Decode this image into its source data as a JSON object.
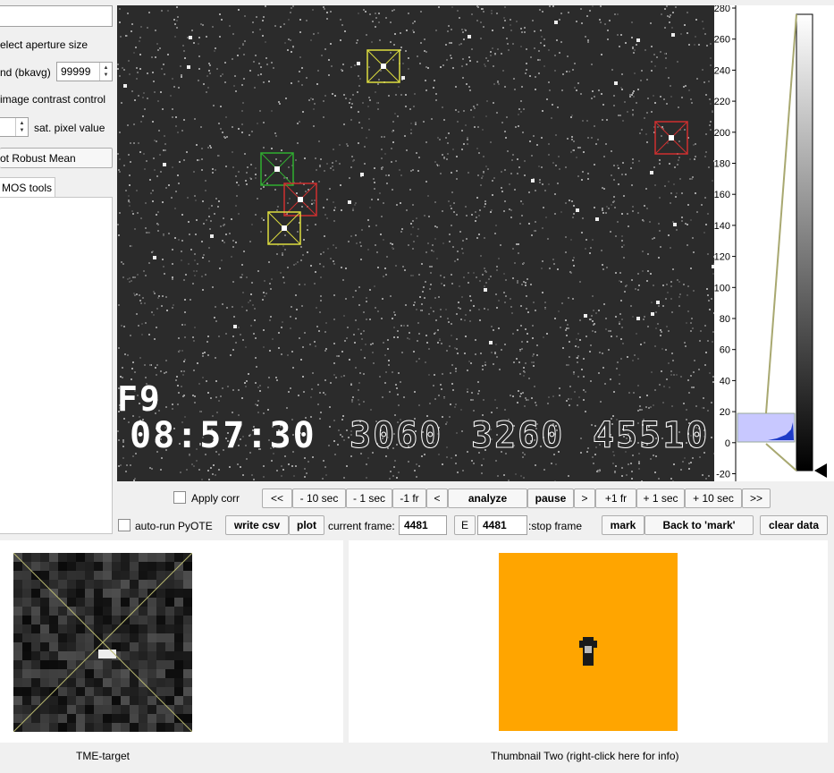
{
  "left_panel": {
    "input_value": "",
    "aperture_label": "elect aperture size",
    "bkavg_label": "nd (bkavg)",
    "bkavg_value": "99999",
    "contrast_label": "image contrast control",
    "sat_label": "sat. pixel value",
    "sat_value": "",
    "robust_mean_button": "ot Robust Mean",
    "tab_label": "MOS tools"
  },
  "image": {
    "overlay_label": "F9",
    "timestamp": "08:57:30",
    "numbers_outline": [
      "3060",
      "3260",
      "45510"
    ]
  },
  "histogram": {
    "ticks": [
      "280",
      "260",
      "240",
      "220",
      "200",
      "180",
      "160",
      "140",
      "120",
      "100",
      "80",
      "60",
      "40",
      "20",
      "0",
      "-20"
    ],
    "colors": {
      "region": "#c8c8ff",
      "hist_fill": "#1e3cc8",
      "line": "#a8a870"
    }
  },
  "controls_row1": {
    "apply_corr": "Apply corr",
    "btn_back_far": "<<",
    "btn_minus_10s": "- 10 sec",
    "btn_minus_1s": "- 1 sec",
    "btn_minus_1fr": "-1 fr",
    "btn_back": "<",
    "btn_analyze": "analyze",
    "btn_pause": "pause",
    "btn_fwd": ">",
    "btn_plus_1fr": "+1 fr",
    "btn_plus_1s": "+ 1 sec",
    "btn_plus_10s": "+ 10 sec",
    "btn_fwd_far": ">>"
  },
  "controls_row2": {
    "auto_run": "auto-run PyOTE",
    "write_csv": "write csv",
    "plot": "plot",
    "current_frame_label": "current frame:",
    "current_frame_value": "4481",
    "e_button": "E",
    "stop_frame_value": "4481",
    "stop_frame_label": ":stop frame",
    "mark": "mark",
    "back_to_mark": "Back to 'mark'",
    "clear_data": "clear data"
  },
  "thumbnails": {
    "one_label": "TME-target",
    "two_label": "Thumbnail Two (right-click here for info)",
    "two_bg": "#ffa500"
  }
}
